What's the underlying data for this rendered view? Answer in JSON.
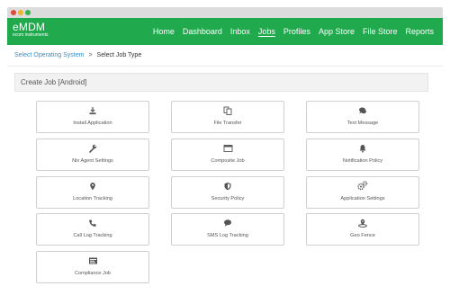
{
  "window": {
    "controls": [
      "close",
      "minimize",
      "maximize"
    ]
  },
  "brand": {
    "name": "eMDM",
    "subtitle": "ecom instruments"
  },
  "nav": {
    "items": [
      {
        "label": "Home"
      },
      {
        "label": "Dashboard"
      },
      {
        "label": "Inbox"
      },
      {
        "label": "Jobs",
        "active": true
      },
      {
        "label": "Profiles"
      },
      {
        "label": "App Store"
      },
      {
        "label": "File Store"
      },
      {
        "label": "Reports"
      }
    ]
  },
  "breadcrumb": {
    "link": "Select Operating System",
    "separator": ">",
    "current": "Select Job Type"
  },
  "panel": {
    "title": "Create Job [Android]"
  },
  "cards": [
    {
      "label": "Install Application",
      "icon": "download-icon"
    },
    {
      "label": "File Transfer",
      "icon": "file-transfer-icon"
    },
    {
      "label": "Text Message",
      "icon": "chat-icon"
    },
    {
      "label": "Nix Agent Settings",
      "icon": "wrench-icon"
    },
    {
      "label": "Composite Job",
      "icon": "composite-icon"
    },
    {
      "label": "Notification Policy",
      "icon": "bell-icon"
    },
    {
      "label": "Location Tracking",
      "icon": "location-pin-icon"
    },
    {
      "label": "Security Policy",
      "icon": "shield-icon"
    },
    {
      "label": "Application Settings",
      "icon": "gears-icon"
    },
    {
      "label": "Call Log Tracking",
      "icon": "phone-icon"
    },
    {
      "label": "SMS Log Tracking",
      "icon": "comment-icon"
    },
    {
      "label": "Geo Fence",
      "icon": "geo-fence-icon"
    },
    {
      "label": "Compliance Job",
      "icon": "compliance-icon"
    }
  ],
  "colors": {
    "navbar": "#21a94e",
    "link": "#3a8fc9",
    "icon": "#555555"
  }
}
